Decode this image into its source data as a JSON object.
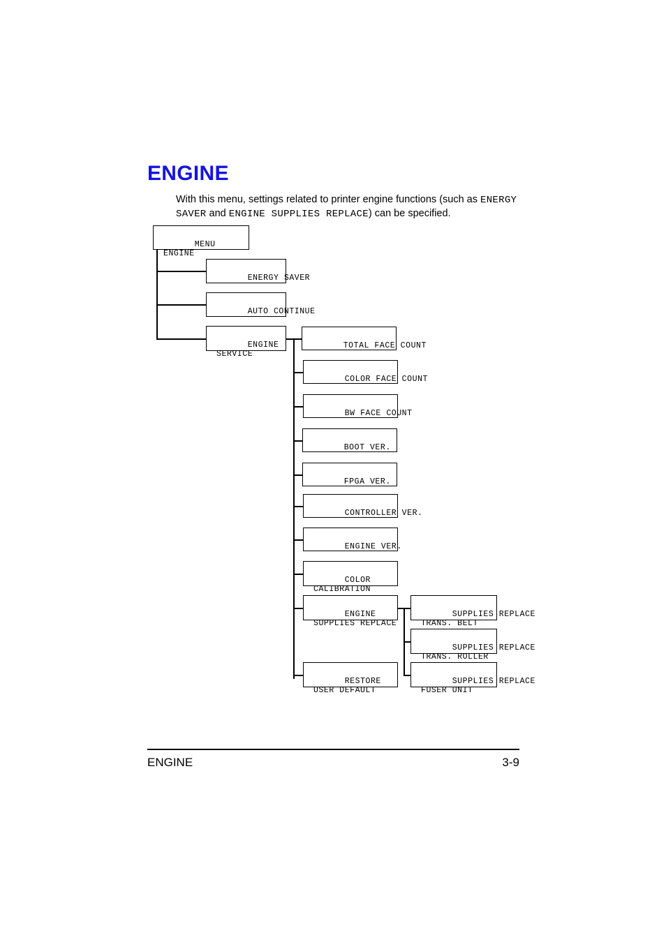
{
  "page": {
    "heading": "ENGINE",
    "heading_color": "#1414e0",
    "intro": {
      "part1": "With this menu, settings related to printer engine functions (such as ",
      "mono1": "ENERGY SAVER",
      "part2": " and ",
      "mono2": "ENGINE SUPPLIES REPLACE",
      "part3": ") can be specified."
    },
    "footer": {
      "left": "ENGINE",
      "right": "3-9"
    }
  },
  "diagram": {
    "root": {
      "line1": "MENU",
      "line2": "ENGINE"
    },
    "level2": [
      {
        "line1": "ENERGY SAVER",
        "line2": ""
      },
      {
        "line1": "AUTO CONTINUE",
        "line2": ""
      },
      {
        "line1": "ENGINE",
        "line2": "SERVICE"
      }
    ],
    "level3": [
      {
        "line1": "TOTAL FACE COUNT",
        "line2": ""
      },
      {
        "line1": "COLOR FACE COUNT",
        "line2": ""
      },
      {
        "line1": "BW FACE COUNT",
        "line2": ""
      },
      {
        "line1": "BOOT VER.",
        "line2": ""
      },
      {
        "line1": "FPGA VER.",
        "line2": ""
      },
      {
        "line1": "CONTROLLER VER.",
        "line2": ""
      },
      {
        "line1": "ENGINE VER.",
        "line2": ""
      },
      {
        "line1": "COLOR",
        "line2": "CALIBRATION"
      },
      {
        "line1": "ENGINE",
        "line2": "SUPPLIES REPLACE"
      },
      {
        "line1": "RESTORE",
        "line2": "USER DEFAULT"
      }
    ],
    "level4": [
      {
        "line1": "SUPPLIES REPLACE",
        "line2": "TRANS. BELT"
      },
      {
        "line1": "SUPPLIES REPLACE",
        "line2": "TRANS. ROLLER"
      },
      {
        "line1": "SUPPLIES REPLACE",
        "line2": "FUSER UNIT"
      }
    ]
  }
}
